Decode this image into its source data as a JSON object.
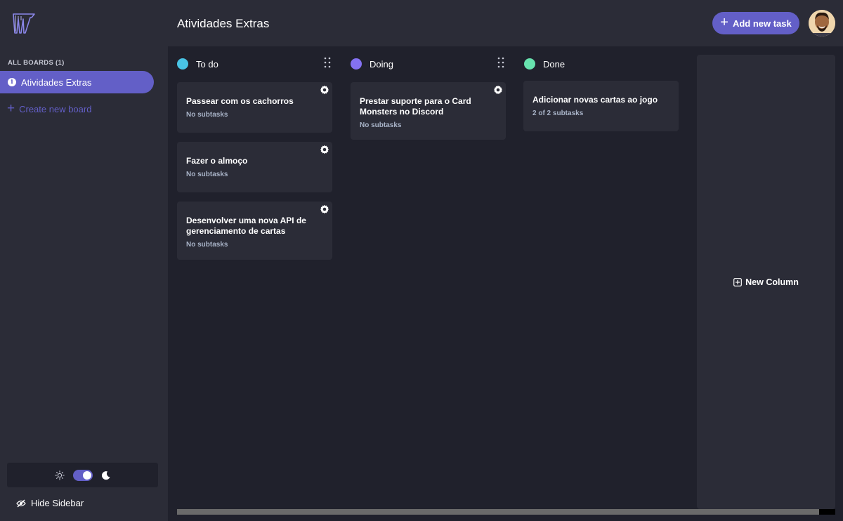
{
  "header": {
    "board_title": "Atividades Extras",
    "add_task_label": "Add new task"
  },
  "sidebar": {
    "section_title": "ALL BOARDS (1)",
    "boards": [
      {
        "label": "Atividades Extras",
        "active": true
      }
    ],
    "create_label": "Create new board",
    "theme": "dark",
    "hide_label": "Hide Sidebar"
  },
  "columns": [
    {
      "name": "To do",
      "color": "#49c4e5",
      "cards": [
        {
          "title": "Passear com os cachorros",
          "subtasks": "No subtasks"
        },
        {
          "title": "Fazer o almoço",
          "subtasks": "No subtasks"
        },
        {
          "title": "Desenvolver uma nova API de gerenciamento de cartas",
          "subtasks": "No subtasks"
        }
      ]
    },
    {
      "name": "Doing",
      "color": "#8471f2",
      "cards": [
        {
          "title": "Prestar suporte para o Card Monsters no Discord",
          "subtasks": "No subtasks"
        }
      ]
    },
    {
      "name": "Done",
      "color": "#67e2ae",
      "cards": [
        {
          "title": "Adicionar novas cartas ao jogo",
          "subtasks": "2 of 2 subtasks"
        }
      ]
    }
  ],
  "new_column_label": "New Column",
  "colors": {
    "accent": "#635fc7",
    "background": "#20212c",
    "surface": "#2b2c37"
  },
  "icons": [
    "logo-icon",
    "plus-icon",
    "info-icon",
    "sun-icon",
    "moon-icon",
    "eye-slash-icon",
    "gear-icon",
    "grip-icon",
    "plus-square-icon"
  ]
}
